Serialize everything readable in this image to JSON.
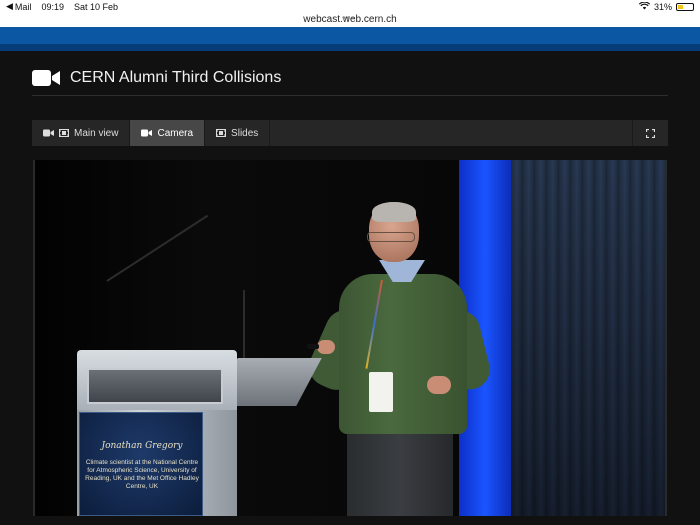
{
  "status_bar": {
    "back_app": "Mail",
    "time": "09:19",
    "date": "Sat 10 Feb",
    "battery_percent": "31%",
    "battery_level": 0.31
  },
  "browser": {
    "url": "webcast.web.cern.ch",
    "more_dots": "•••"
  },
  "page": {
    "title": "CERN Alumni Third Collisions",
    "tabs": [
      {
        "label": "Main view",
        "active": false
      },
      {
        "label": "Camera",
        "active": true
      },
      {
        "label": "Slides",
        "active": false
      }
    ]
  },
  "video": {
    "speaker_name": "Jonathan Gregory",
    "speaker_description": "Climate scientist at the National Centre for Atmospheric Science, University of Reading, UK and the Met Office Hadley Centre, UK"
  },
  "colors": {
    "banner": "#0b57a4",
    "tab_active": "#474747",
    "tab_bar": "#262626"
  }
}
